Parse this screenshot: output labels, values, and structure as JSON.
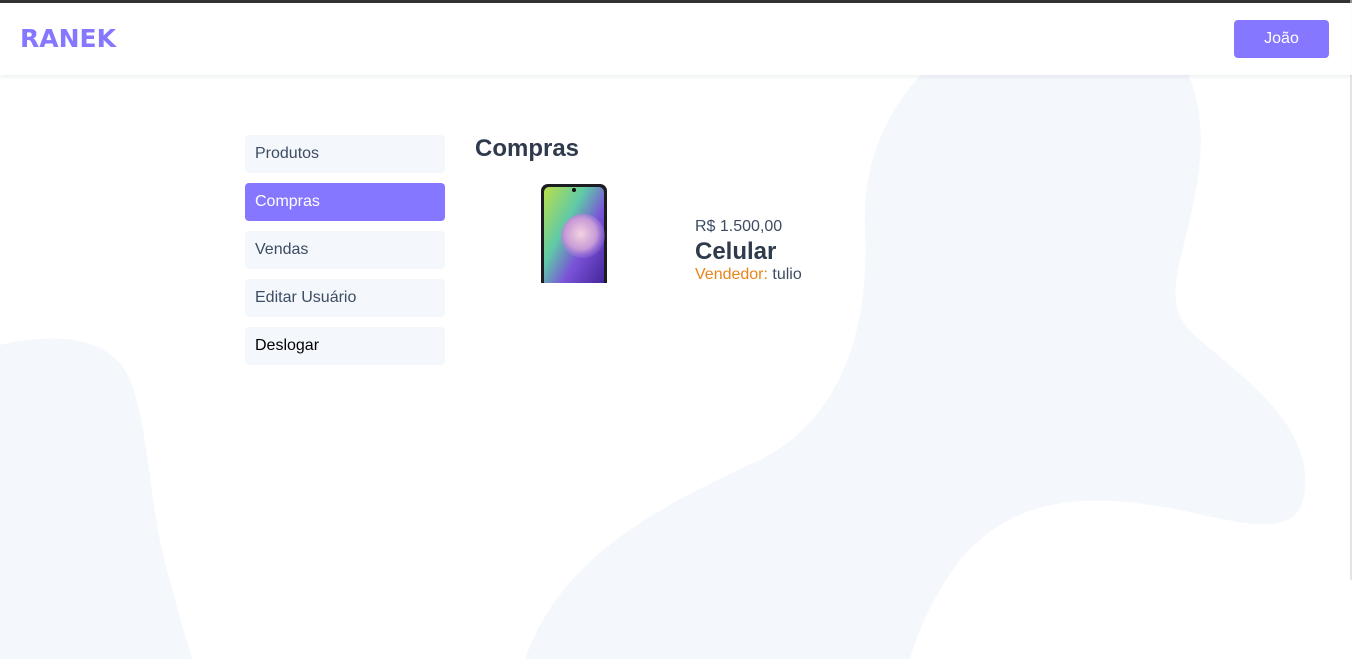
{
  "header": {
    "logo": "RANEK",
    "user_button": "João"
  },
  "nav": {
    "items": [
      {
        "label": "Produtos"
      },
      {
        "label": "Compras"
      },
      {
        "label": "Vendas"
      },
      {
        "label": "Editar Usuário"
      },
      {
        "label": "Deslogar"
      }
    ],
    "active": "Compras"
  },
  "main": {
    "title": "Compras",
    "purchases": [
      {
        "price": "R$ 1.500,00",
        "name": "Celular",
        "seller_label": "Vendedor:",
        "seller": "tulio",
        "image": "phone-image"
      }
    ]
  },
  "colors": {
    "accent": "#8577ff",
    "nav_bg": "#f4f7fc",
    "seller_label": "#e8841a",
    "text": "#3d4c62"
  }
}
